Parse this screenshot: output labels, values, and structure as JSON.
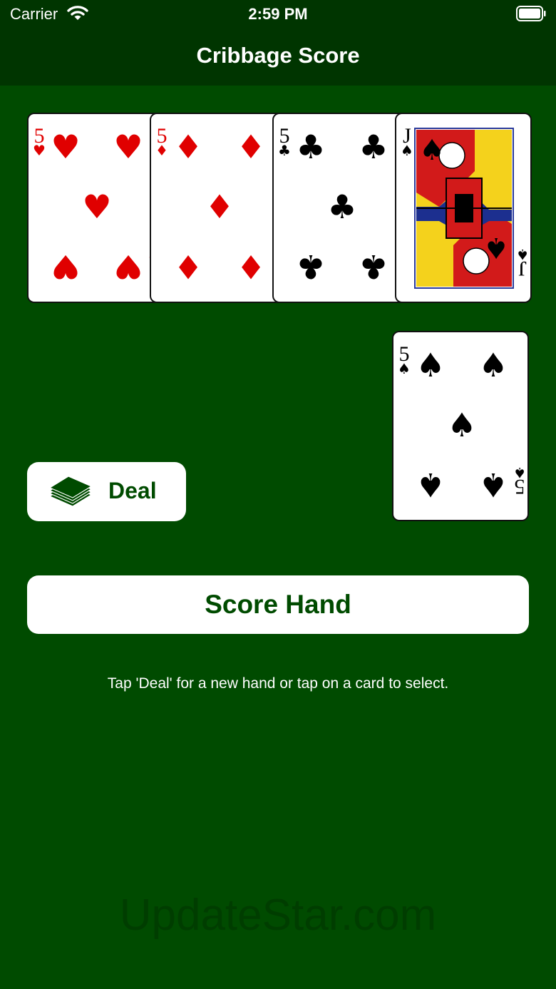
{
  "status_bar": {
    "carrier": "Carrier",
    "time": "2:59 PM",
    "icons": [
      "wifi-icon",
      "battery-icon"
    ]
  },
  "nav": {
    "title": "Cribbage Score"
  },
  "hand": [
    {
      "rank": "5",
      "suit": "hearts",
      "suit_symbol": "♥",
      "color": "#e00000"
    },
    {
      "rank": "5",
      "suit": "diamonds",
      "suit_symbol": "♦",
      "color": "#e00000"
    },
    {
      "rank": "5",
      "suit": "clubs",
      "suit_symbol": "♣",
      "color": "#000000"
    },
    {
      "rank": "J",
      "suit": "spades",
      "suit_symbol": "♠",
      "color": "#000000"
    }
  ],
  "starter_card": {
    "rank": "5",
    "suit": "spades",
    "suit_symbol": "♠",
    "color": "#000000"
  },
  "deal_button": {
    "label": "Deal",
    "icon": "card-deck-icon"
  },
  "score_button": {
    "label": "Score Hand"
  },
  "hint_text": "Tap 'Deal' for a new hand or tap on a card to select.",
  "watermark": "UpdateStar.com",
  "colors": {
    "felt": "#004b00",
    "nav_bar": "#003500",
    "button_text": "#004b00",
    "red_suit": "#e00000"
  }
}
